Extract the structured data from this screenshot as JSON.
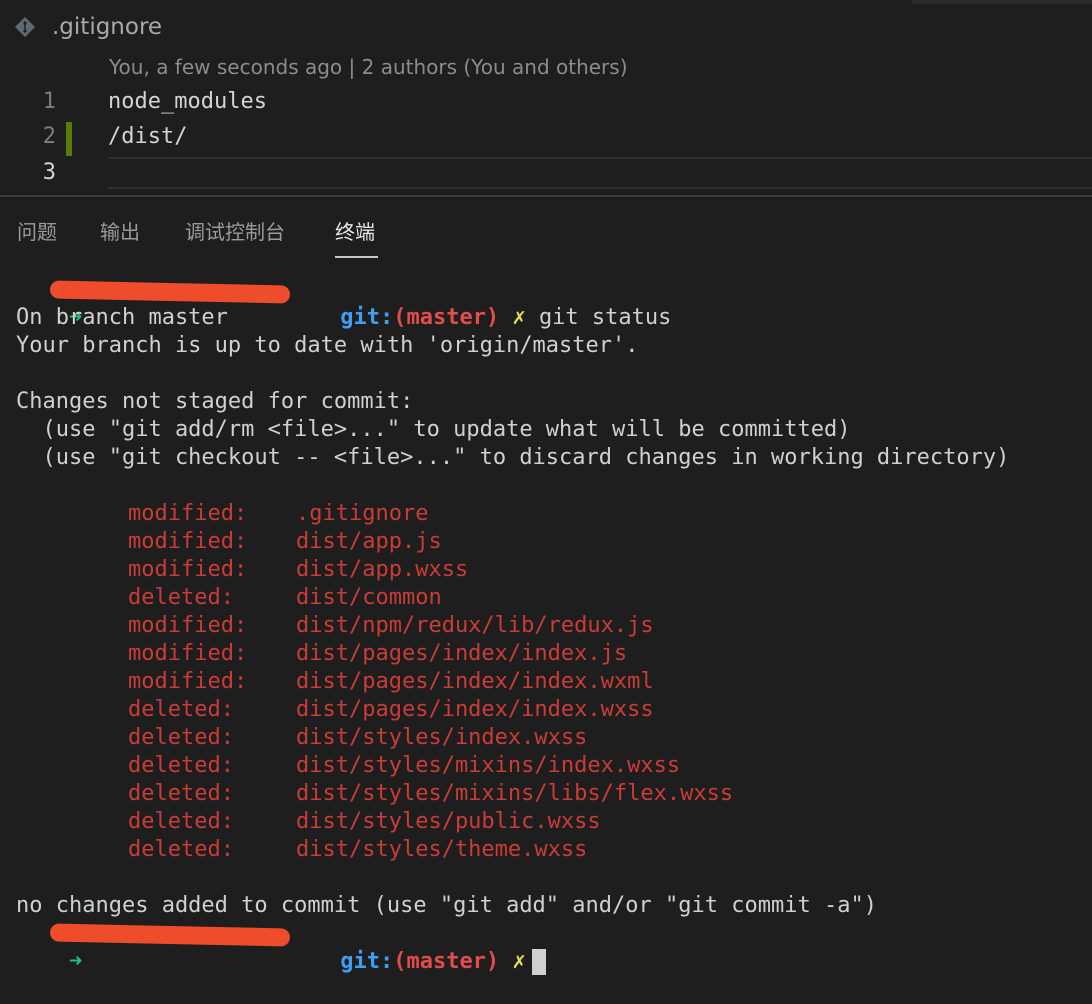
{
  "editor": {
    "file_name": ".gitignore",
    "blame": "You, a few seconds ago | 2 authors (You and others)",
    "lines": [
      {
        "number": "1",
        "text": "node_modules"
      },
      {
        "number": "2",
        "text": "/dist/"
      },
      {
        "number": "3",
        "text": ""
      }
    ]
  },
  "panel": {
    "tabs": [
      "问题",
      "输出",
      "调试控制台",
      "终端"
    ],
    "active_tab": "终端"
  },
  "terminal": {
    "prompt_arrow": "➜",
    "prompt_git": "git:",
    "prompt_branch": "(master)",
    "prompt_x": "✗",
    "command": "git status",
    "output": {
      "on_branch": "On branch master",
      "up_to_date": "Your branch is up to date with 'origin/master'.",
      "not_staged": "Changes not staged for commit:",
      "hint1": "  (use \"git add/rm <file>...\" to update what will be committed)",
      "hint2": "  (use \"git checkout -- <file>...\" to discard changes in working directory)",
      "changes": [
        {
          "status": "modified:",
          "path": ".gitignore"
        },
        {
          "status": "modified:",
          "path": "dist/app.js"
        },
        {
          "status": "modified:",
          "path": "dist/app.wxss"
        },
        {
          "status": "deleted:",
          "path": "dist/common"
        },
        {
          "status": "modified:",
          "path": "dist/npm/redux/lib/redux.js"
        },
        {
          "status": "modified:",
          "path": "dist/pages/index/index.js"
        },
        {
          "status": "modified:",
          "path": "dist/pages/index/index.wxml"
        },
        {
          "status": "deleted:",
          "path": "dist/pages/index/index.wxss"
        },
        {
          "status": "deleted:",
          "path": "dist/styles/index.wxss"
        },
        {
          "status": "deleted:",
          "path": "dist/styles/mixins/index.wxss"
        },
        {
          "status": "deleted:",
          "path": "dist/styles/mixins/libs/flex.wxss"
        },
        {
          "status": "deleted:",
          "path": "dist/styles/public.wxss"
        },
        {
          "status": "deleted:",
          "path": "dist/styles/theme.wxss"
        }
      ],
      "footer": "no changes added to commit (use \"git add\" and/or \"git commit -a\")"
    }
  },
  "colors": {
    "background": "#1e1e1e",
    "git_label": "#3e9ef0",
    "branch": "#e24c4c",
    "changed_file": "#c93c37",
    "prompt_arrow": "#1fc07a",
    "dirty_mark": "#e5e04f",
    "redaction": "#ef4c2b"
  }
}
